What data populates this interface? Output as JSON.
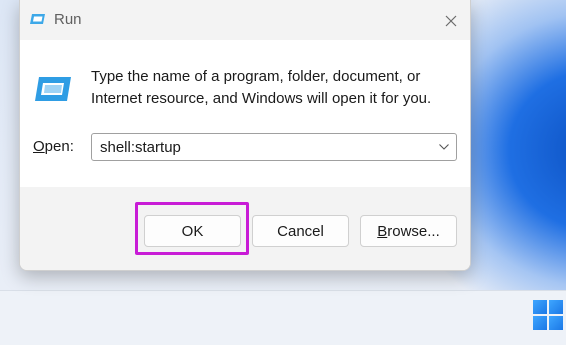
{
  "dialog": {
    "title": "Run",
    "close_glyph": "✕",
    "description": "Type the name of a program, folder, document, or Internet resource, and Windows will open it for you.",
    "open_label_first": "O",
    "open_label_rest": "pen:",
    "open_value": "shell:startup",
    "buttons": {
      "ok": "OK",
      "cancel": "Cancel",
      "browse_first": "B",
      "browse_rest": "rowse..."
    }
  },
  "icons": {
    "title": "run-icon",
    "big": "run-icon",
    "close": "close-icon",
    "dropdown": "chevron-down-icon",
    "start": "windows-logo-icon"
  },
  "colors": {
    "highlight": "#c81bd6",
    "accent": "#1b78e6"
  }
}
